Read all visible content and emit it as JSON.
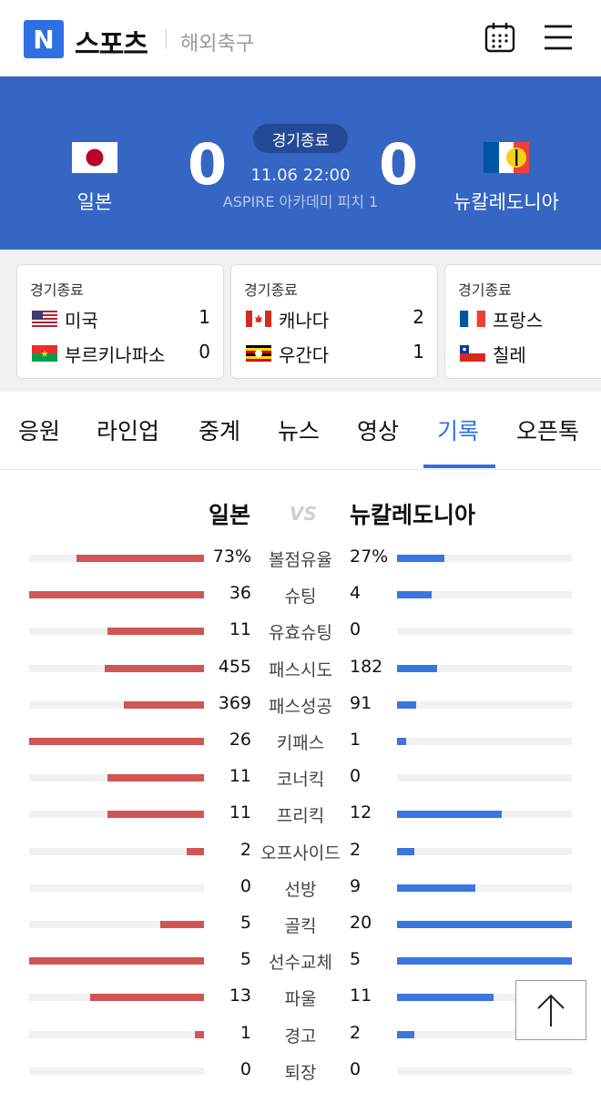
{
  "header": {
    "logo": "N",
    "brand": "스포츠",
    "section": "해외축구",
    "icons": [
      "calendar-icon",
      "menu-icon"
    ]
  },
  "match": {
    "home_name": "일본",
    "away_name": "뉴칼레도니아",
    "home_score": "0",
    "away_score": "0",
    "status": "경기종료",
    "time": "11.06 22:00",
    "venue": "ASPIRE 아카데미 피치 1"
  },
  "other_matches": [
    {
      "status": "경기종료",
      "home": "미국",
      "home_score": "1",
      "away": "부르키나파소",
      "away_score": "0"
    },
    {
      "status": "경기종료",
      "home": "캐나다",
      "home_score": "2",
      "away": "우간다",
      "away_score": "1"
    },
    {
      "status": "경기종료",
      "home": "프랑스",
      "home_score": "",
      "away": "칠레",
      "away_score": ""
    }
  ],
  "tabs": [
    "응원",
    "라인업",
    "중계",
    "뉴스",
    "영상",
    "기록",
    "오픈톡"
  ],
  "active_tab": "기록",
  "stats": {
    "home_name": "일본",
    "away_name": "뉴칼레도니아",
    "vs": "VS",
    "rows": [
      {
        "label": "볼점유율",
        "home": "73%",
        "away": "27%",
        "home_frac": 0.73,
        "away_frac": 0.27
      },
      {
        "label": "슈팅",
        "home": "36",
        "away": "4",
        "home_frac": 1.0,
        "away_frac": 0.2
      },
      {
        "label": "유효슈팅",
        "home": "11",
        "away": "0",
        "home_frac": 0.55,
        "away_frac": 0.0
      },
      {
        "label": "패스시도",
        "home": "455",
        "away": "182",
        "home_frac": 0.57,
        "away_frac": 0.23
      },
      {
        "label": "패스성공",
        "home": "369",
        "away": "91",
        "home_frac": 0.46,
        "away_frac": 0.11
      },
      {
        "label": "키패스",
        "home": "26",
        "away": "1",
        "home_frac": 1.0,
        "away_frac": 0.05
      },
      {
        "label": "코너킥",
        "home": "11",
        "away": "0",
        "home_frac": 0.55,
        "away_frac": 0.0
      },
      {
        "label": "프리킥",
        "home": "11",
        "away": "12",
        "home_frac": 0.55,
        "away_frac": 0.6
      },
      {
        "label": "오프사이드",
        "home": "2",
        "away": "2",
        "home_frac": 0.1,
        "away_frac": 0.1
      },
      {
        "label": "선방",
        "home": "0",
        "away": "9",
        "home_frac": 0.0,
        "away_frac": 0.45
      },
      {
        "label": "골킥",
        "home": "5",
        "away": "20",
        "home_frac": 0.25,
        "away_frac": 1.0
      },
      {
        "label": "선수교체",
        "home": "5",
        "away": "5",
        "home_frac": 1.0,
        "away_frac": 1.0
      },
      {
        "label": "파울",
        "home": "13",
        "away": "11",
        "home_frac": 0.65,
        "away_frac": 0.55
      },
      {
        "label": "경고",
        "home": "1",
        "away": "2",
        "home_frac": 0.05,
        "away_frac": 0.1
      },
      {
        "label": "퇴장",
        "home": "0",
        "away": "0",
        "home_frac": 0.0,
        "away_frac": 0.0
      }
    ]
  },
  "colors": {
    "brand": "#2f6fe4",
    "scoreboard": "#3566c4",
    "home_bar": "#d05555",
    "away_bar": "#3a75e0"
  },
  "scroll_top_icon": "arrow-up-icon"
}
